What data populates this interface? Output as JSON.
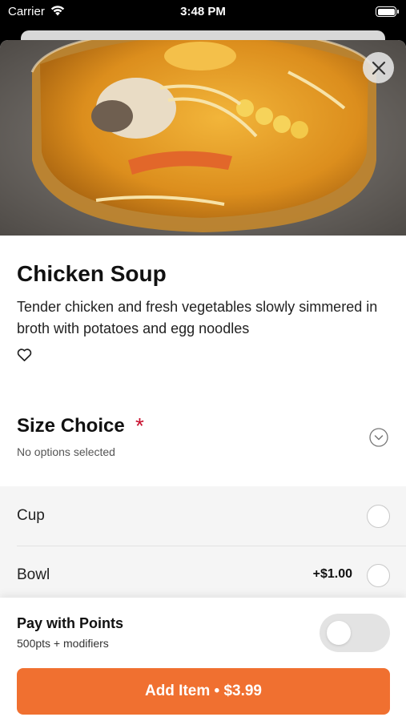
{
  "status_bar": {
    "carrier": "Carrier",
    "time": "3:48 PM"
  },
  "item": {
    "title": "Chicken Soup",
    "description": "Tender chicken and fresh vegetables slowly simmered in broth with potatoes and egg noodles"
  },
  "size_choice": {
    "heading": "Size Choice",
    "required_marker": "*",
    "status": "No options selected",
    "options": [
      {
        "label": "Cup",
        "price": ""
      },
      {
        "label": "Bowl",
        "price": "+$1.00"
      }
    ]
  },
  "points": {
    "title": "Pay with Points",
    "subtitle": "500pts + modifiers",
    "enabled": false
  },
  "add_button": {
    "label": "Add Item • $3.99"
  },
  "colors": {
    "accent": "#f07030",
    "required": "#c8102e"
  },
  "icons": [
    "wifi-icon",
    "battery-icon",
    "close-icon",
    "heart-icon",
    "chevron-down-icon"
  ]
}
